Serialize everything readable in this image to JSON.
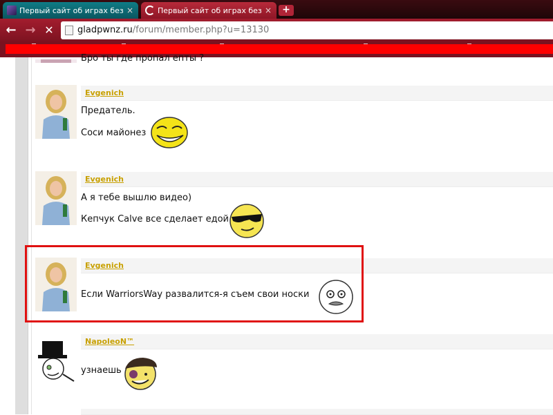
{
  "browser": {
    "tabs": [
      {
        "title": "Первый сайт об играх без це",
        "active": false
      },
      {
        "title": "Первый сайт об играх без це",
        "active": true
      }
    ],
    "new_tab_label": "+",
    "close_glyph": "×",
    "nav": {
      "back": "←",
      "forward": "→",
      "stop": "✕"
    },
    "url_host": "gladpwnz.ru",
    "url_path": "/forum/member.php?u=13130"
  },
  "posts": [
    {
      "author": "",
      "lines": [
        "Бро ты где пропал епты ?"
      ]
    },
    {
      "author": "Evgenich",
      "lines": [
        "Предатель.",
        "Соси майонез"
      ],
      "smiley": "trollface"
    },
    {
      "author": "Evgenich",
      "lines": [
        "А я тебе вышлю видео)",
        "Кепчук Calve все сделает едой"
      ],
      "smiley": "cool-sunglasses"
    },
    {
      "author": "Evgenich",
      "lines": [
        "Если WarriorsWay развалится-я съем свои носки"
      ],
      "smiley": "me-gusta"
    },
    {
      "author": "NapoleoN™",
      "lines": [
        "узнаешь"
      ],
      "smiley": "soldier-beret"
    }
  ],
  "colors": {
    "author_link": "#c8a000",
    "highlight_box": "#e01010",
    "toolbar": "#a31d2e",
    "bookmark_bar": "#ff0000"
  }
}
